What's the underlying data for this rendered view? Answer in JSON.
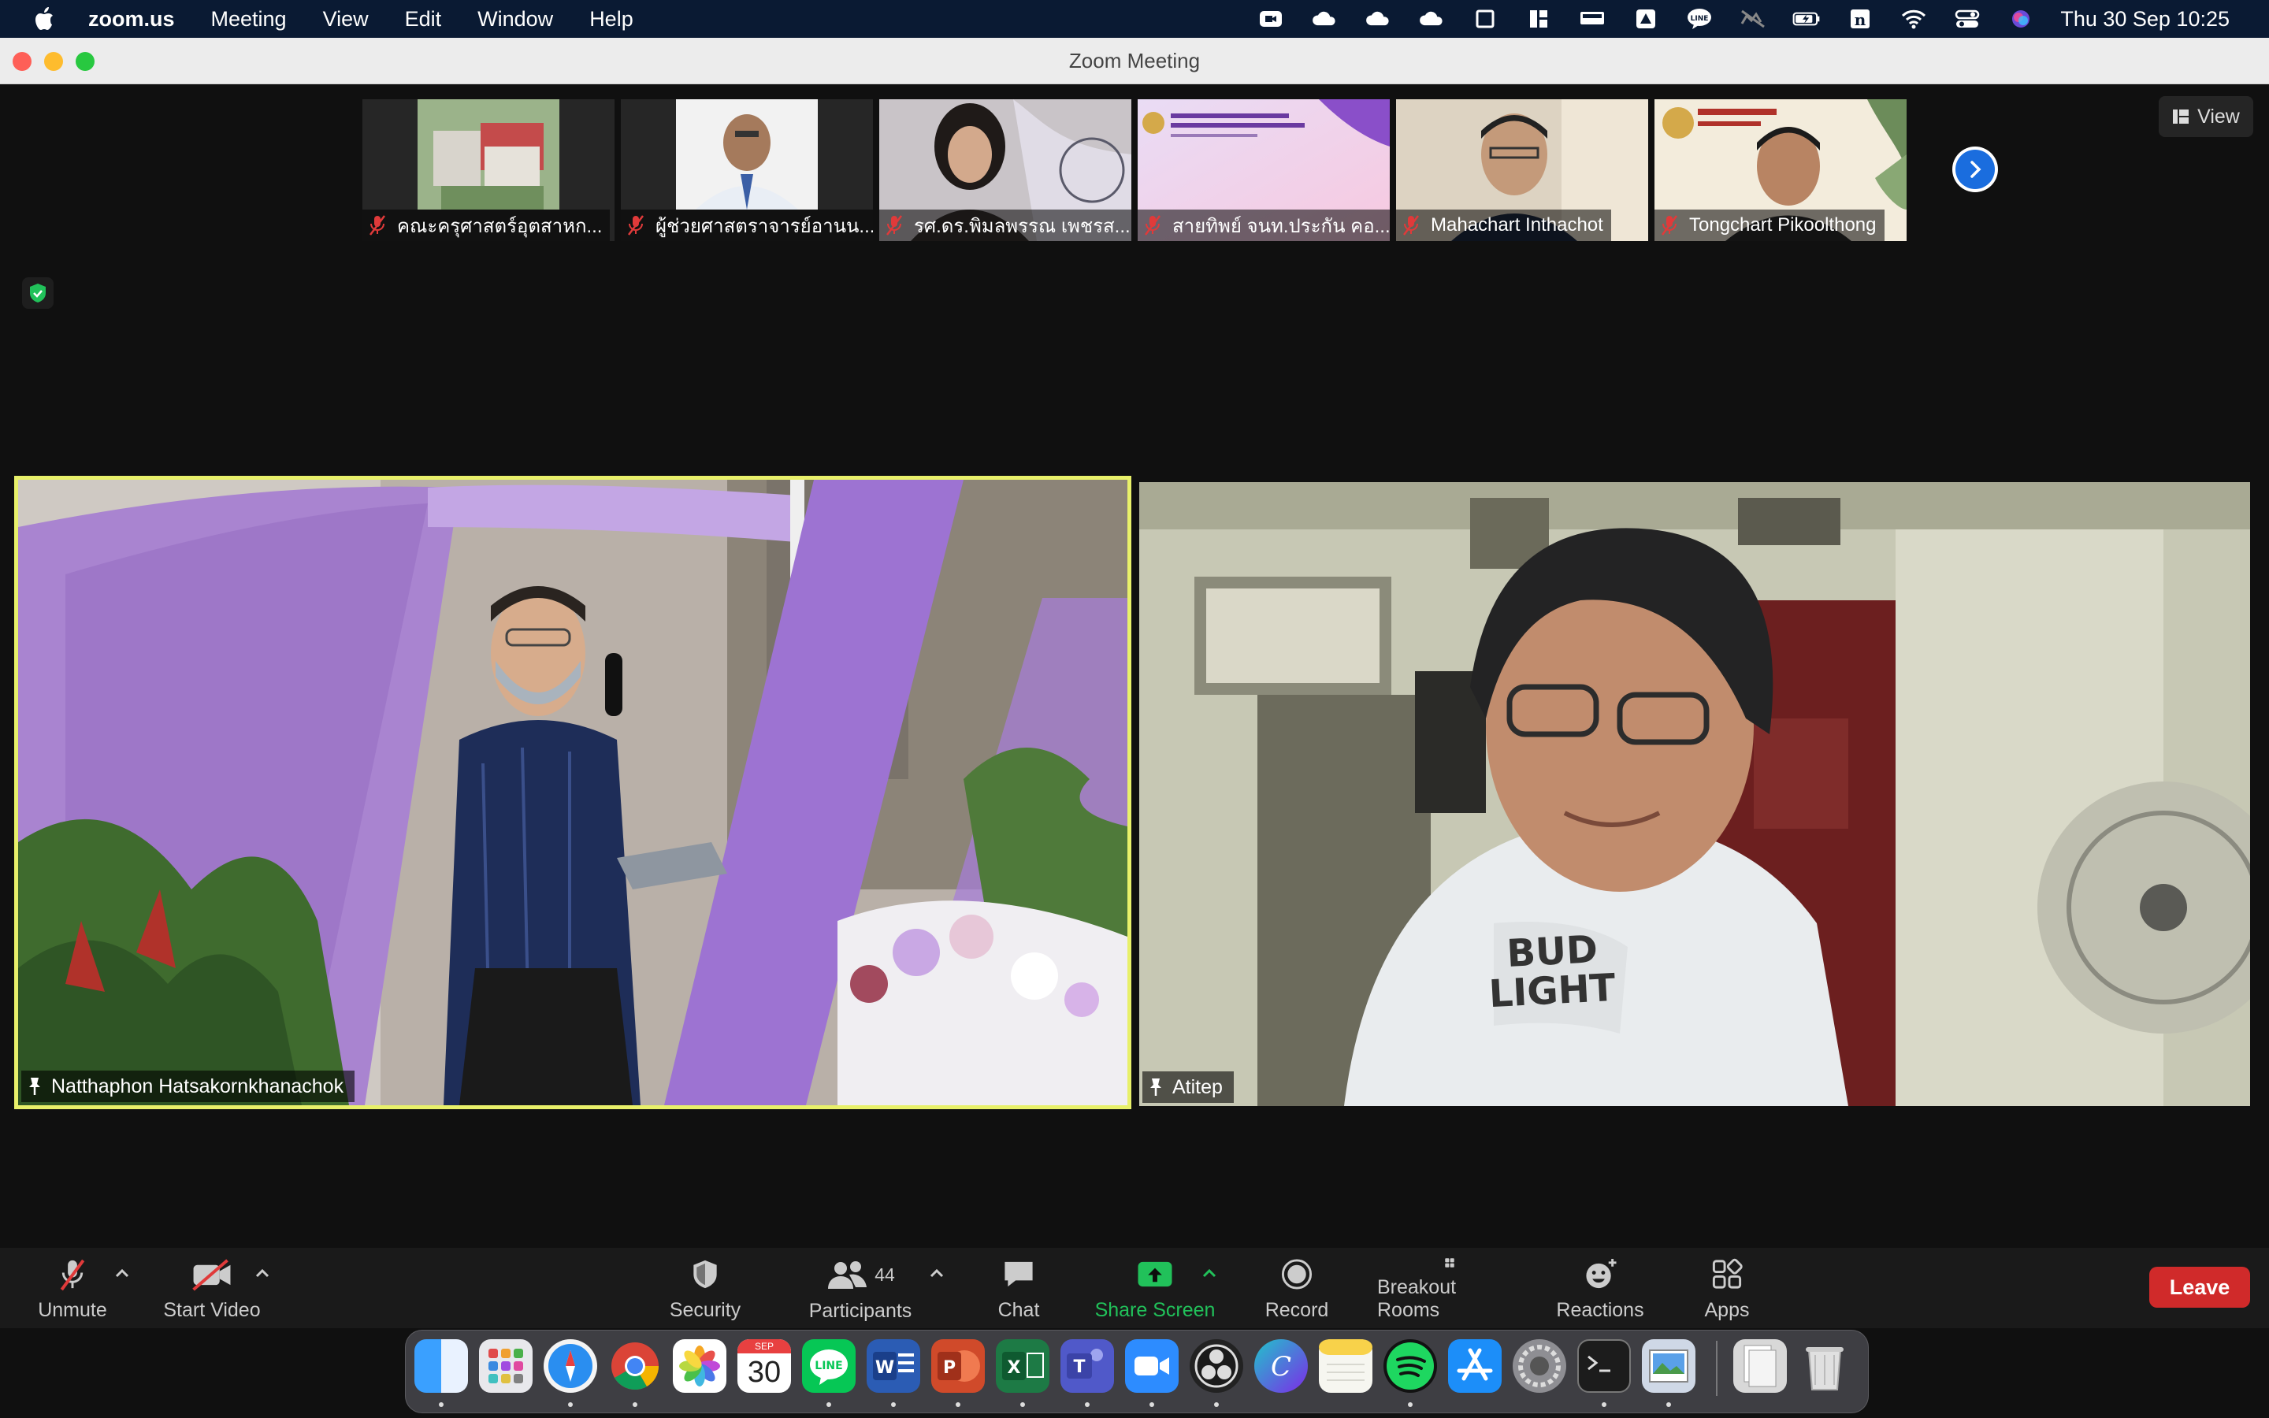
{
  "menubar": {
    "app_name": "zoom.us",
    "items": [
      "Meeting",
      "View",
      "Edit",
      "Window",
      "Help"
    ],
    "clock": "Thu 30 Sep  10:25"
  },
  "window": {
    "title": "Zoom Meeting"
  },
  "filmstrip": {
    "participants": [
      {
        "name": "คณะครุศาสตร์อุตสาหก...",
        "muted": true
      },
      {
        "name": "ผู้ช่วยศาสตราจารย์อานน...",
        "muted": true
      },
      {
        "name": "รศ.ดร.พิมลพรรณ เพชรส...",
        "muted": true
      },
      {
        "name": "สายทิพย์ จนท.ประกัน คอ...",
        "muted": true
      },
      {
        "name": "Mahachart Inthachot",
        "muted": true
      },
      {
        "name": "Tongchart Pikoolthong",
        "muted": true
      }
    ],
    "view_label": "View"
  },
  "main_videos": {
    "left": {
      "name": "Natthaphon Hatsakornkhanachok",
      "pinned": true,
      "active_speaker": true
    },
    "right": {
      "name": "Atitep",
      "pinned": true
    }
  },
  "toolbar": {
    "unmute": "Unmute",
    "start_video": "Start Video",
    "security": "Security",
    "participants": "Participants",
    "participant_count": "44",
    "chat": "Chat",
    "share_screen": "Share Screen",
    "record": "Record",
    "breakout_rooms": "Breakout Rooms",
    "reactions": "Reactions",
    "apps": "Apps",
    "leave": "Leave"
  },
  "dock": {
    "calendar_month": "SEP",
    "calendar_day": "30",
    "apps": [
      "Finder",
      "Launchpad",
      "Safari",
      "Chrome",
      "Photos",
      "Calendar",
      "LINE",
      "Word",
      "PowerPoint",
      "Excel",
      "Teams",
      "Zoom",
      "OBS",
      "Canva",
      "Notes",
      "Spotify",
      "App Store",
      "System Preferences",
      "Terminal",
      "Preview",
      "Documents",
      "Trash"
    ]
  },
  "colors": {
    "accent_green": "#21c15a",
    "leave_red": "#d02a2a",
    "active_speaker_border": "#e8f06a",
    "zoom_blue": "#1a6dde"
  }
}
